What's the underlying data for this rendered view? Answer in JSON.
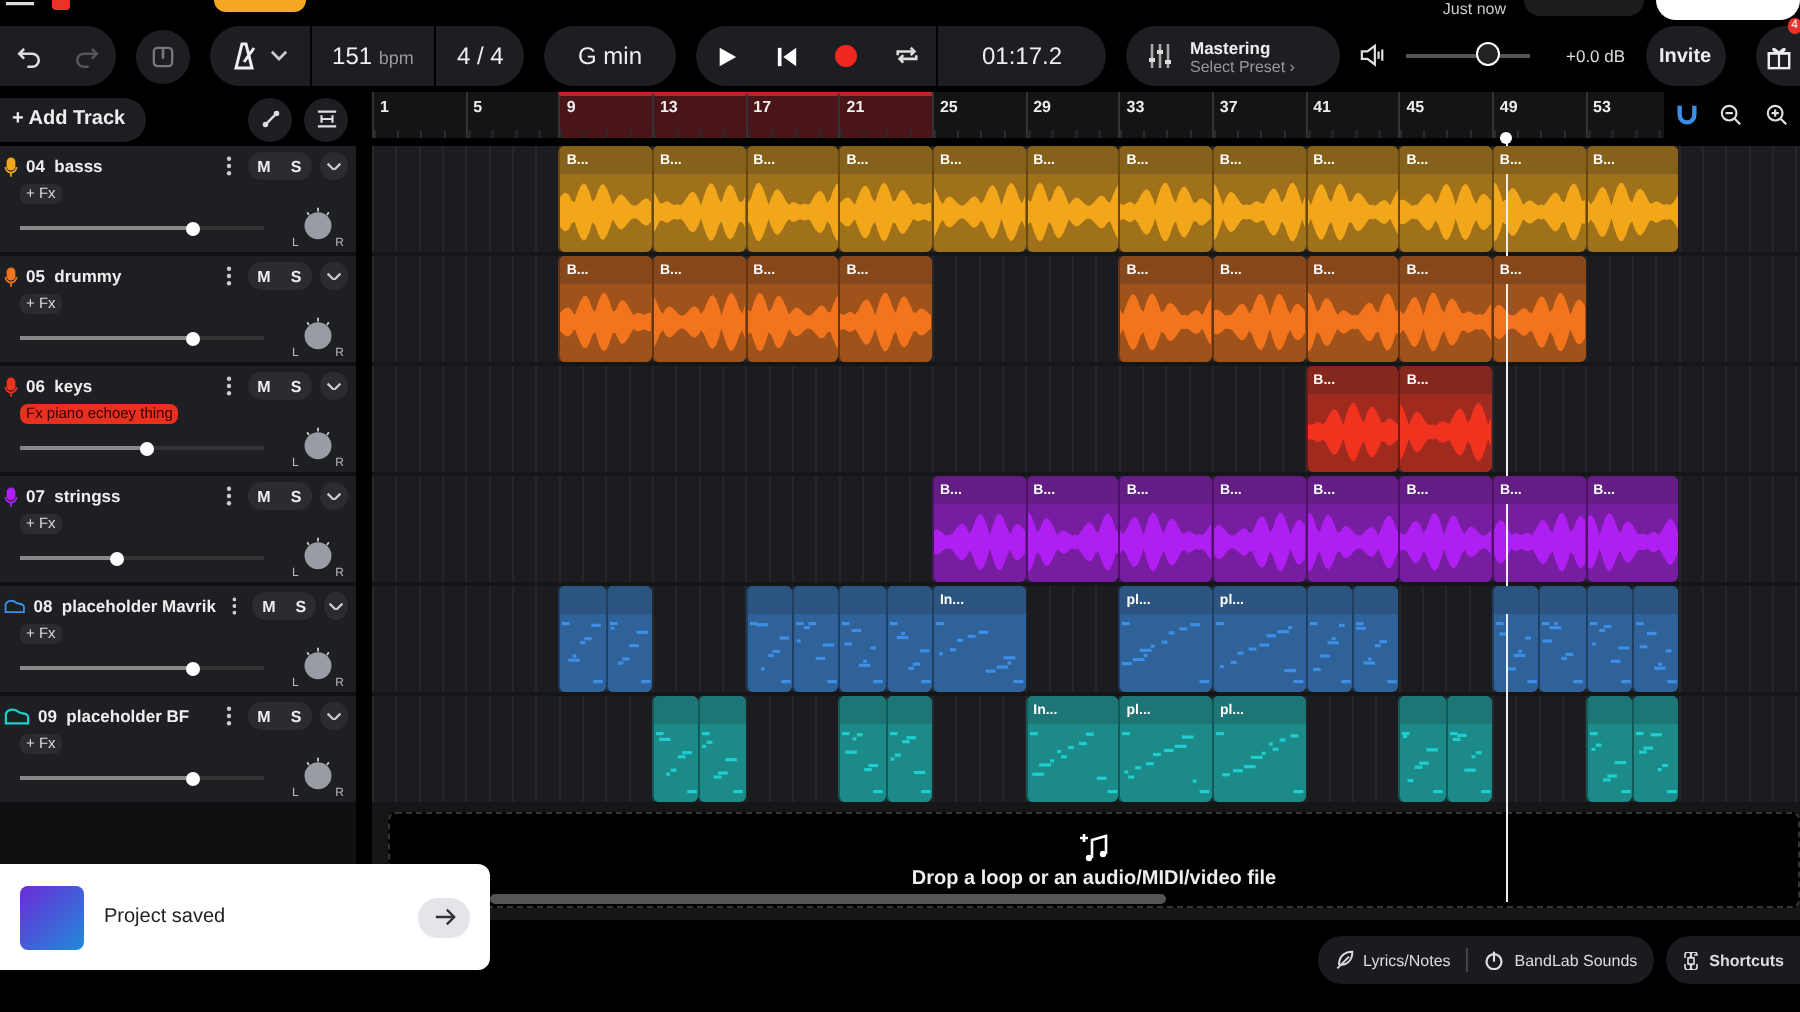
{
  "header": {
    "save_status": "Just now"
  },
  "toolbar": {
    "undo": {
      "disabled": false
    },
    "redo": {
      "disabled": true
    },
    "tempo": "151",
    "tempo_unit": "bpm",
    "time_signature": "4 / 4",
    "key": "G min",
    "time": "01:17.2",
    "mastering": {
      "title": "Mastering",
      "preset": "Select Preset ›"
    },
    "volume": {
      "level": 0.66
    },
    "gain": "+0.0 dB",
    "invite": "Invite",
    "gift_badge": "4"
  },
  "add_track": "+ Add Track",
  "ruler": [
    {
      "label": "1",
      "in_loop": false
    },
    {
      "label": "5",
      "in_loop": false
    },
    {
      "label": "9",
      "in_loop": true
    },
    {
      "label": "13",
      "in_loop": true
    },
    {
      "label": "17",
      "in_loop": true
    },
    {
      "label": "21",
      "in_loop": true
    },
    {
      "label": "25",
      "in_loop": false
    },
    {
      "label": "29",
      "in_loop": false
    },
    {
      "label": "33",
      "in_loop": false
    },
    {
      "label": "37",
      "in_loop": false
    },
    {
      "label": "41",
      "in_loop": false
    },
    {
      "label": "45",
      "in_loop": false
    },
    {
      "label": "49",
      "in_loop": false
    },
    {
      "label": "53",
      "in_loop": false
    }
  ],
  "tracks": [
    {
      "name": "04  basss",
      "kind": "audio",
      "color": "#f2a71b",
      "fx": {
        "label": "+ Fx",
        "active": false
      },
      "mute": "M",
      "solo": "S",
      "level": 0.71,
      "pan": {
        "left": "L",
        "right": "R"
      },
      "cells": [
        {
          "kind": "empty"
        },
        {
          "kind": "empty"
        },
        {
          "kind": "empty"
        },
        {
          "kind": "empty"
        },
        {
          "kind": "start",
          "label": "B..."
        },
        {
          "kind": "cont"
        },
        {
          "kind": "start",
          "label": "B..."
        },
        {
          "kind": "cont"
        },
        {
          "kind": "start",
          "label": "B..."
        },
        {
          "kind": "cont"
        },
        {
          "kind": "start",
          "label": "B..."
        },
        {
          "kind": "cont"
        },
        {
          "kind": "start",
          "label": "B..."
        },
        {
          "kind": "cont"
        },
        {
          "kind": "start",
          "label": "B..."
        },
        {
          "kind": "cont"
        },
        {
          "kind": "start",
          "label": "B..."
        },
        {
          "kind": "cont"
        },
        {
          "kind": "start",
          "label": "B..."
        },
        {
          "kind": "cont"
        },
        {
          "kind": "start",
          "label": "B..."
        },
        {
          "kind": "cont"
        },
        {
          "kind": "start",
          "label": "B..."
        },
        {
          "kind": "cont"
        },
        {
          "kind": "start",
          "label": "B..."
        },
        {
          "kind": "cont"
        },
        {
          "kind": "start",
          "label": "B..."
        },
        {
          "kind": "cont"
        }
      ]
    },
    {
      "name": "05  drummy",
      "kind": "audio",
      "color": "#f2741c",
      "fx": {
        "label": "+ Fx",
        "active": false
      },
      "mute": "M",
      "solo": "S",
      "level": 0.71,
      "pan": {
        "left": "L",
        "right": "R"
      },
      "cells": [
        {
          "kind": "empty"
        },
        {
          "kind": "empty"
        },
        {
          "kind": "empty"
        },
        {
          "kind": "empty"
        },
        {
          "kind": "start",
          "label": "B..."
        },
        {
          "kind": "cont"
        },
        {
          "kind": "start",
          "label": "B..."
        },
        {
          "kind": "cont"
        },
        {
          "kind": "start",
          "label": "B..."
        },
        {
          "kind": "cont"
        },
        {
          "kind": "start",
          "label": "B..."
        },
        {
          "kind": "cont"
        },
        {
          "kind": "empty"
        },
        {
          "kind": "empty"
        },
        {
          "kind": "empty"
        },
        {
          "kind": "empty"
        },
        {
          "kind": "start",
          "label": "B..."
        },
        {
          "kind": "cont"
        },
        {
          "kind": "start",
          "label": "B..."
        },
        {
          "kind": "cont"
        },
        {
          "kind": "start",
          "label": "B..."
        },
        {
          "kind": "cont"
        },
        {
          "kind": "start",
          "label": "B..."
        },
        {
          "kind": "cont"
        },
        {
          "kind": "start",
          "label": "B..."
        },
        {
          "kind": "cont"
        },
        {
          "kind": "empty"
        },
        {
          "kind": "empty"
        }
      ]
    },
    {
      "name": "06  keys",
      "kind": "audio",
      "color": "#f0331f",
      "fx": {
        "label": "Fx piano echoey thing",
        "active": true
      },
      "mute": "M",
      "solo": "S",
      "level": 0.52,
      "pan": {
        "left": "L",
        "right": "R"
      },
      "cells": [
        {
          "kind": "empty"
        },
        {
          "kind": "empty"
        },
        {
          "kind": "empty"
        },
        {
          "kind": "empty"
        },
        {
          "kind": "empty"
        },
        {
          "kind": "empty"
        },
        {
          "kind": "empty"
        },
        {
          "kind": "empty"
        },
        {
          "kind": "empty"
        },
        {
          "kind": "empty"
        },
        {
          "kind": "empty"
        },
        {
          "kind": "empty"
        },
        {
          "kind": "empty"
        },
        {
          "kind": "empty"
        },
        {
          "kind": "empty"
        },
        {
          "kind": "empty"
        },
        {
          "kind": "empty"
        },
        {
          "kind": "empty"
        },
        {
          "kind": "empty"
        },
        {
          "kind": "empty"
        },
        {
          "kind": "start",
          "label": "B..."
        },
        {
          "kind": "cont"
        },
        {
          "kind": "start",
          "label": "B..."
        },
        {
          "kind": "cont"
        },
        {
          "kind": "empty"
        },
        {
          "kind": "empty"
        },
        {
          "kind": "empty"
        },
        {
          "kind": "empty"
        }
      ]
    },
    {
      "name": "07  stringss",
      "kind": "audio",
      "color": "#b01ff2",
      "fx": {
        "label": "+ Fx",
        "active": false
      },
      "mute": "M",
      "solo": "S",
      "level": 0.4,
      "pan": {
        "left": "L",
        "right": "R"
      },
      "cells": [
        {
          "kind": "empty"
        },
        {
          "kind": "empty"
        },
        {
          "kind": "empty"
        },
        {
          "kind": "empty"
        },
        {
          "kind": "empty"
        },
        {
          "kind": "empty"
        },
        {
          "kind": "empty"
        },
        {
          "kind": "empty"
        },
        {
          "kind": "empty"
        },
        {
          "kind": "empty"
        },
        {
          "kind": "empty"
        },
        {
          "kind": "empty"
        },
        {
          "kind": "start",
          "label": "B..."
        },
        {
          "kind": "cont"
        },
        {
          "kind": "start",
          "label": "B..."
        },
        {
          "kind": "cont"
        },
        {
          "kind": "start",
          "label": "B..."
        },
        {
          "kind": "cont"
        },
        {
          "kind": "start",
          "label": "B..."
        },
        {
          "kind": "cont"
        },
        {
          "kind": "start",
          "label": "B..."
        },
        {
          "kind": "cont"
        },
        {
          "kind": "start",
          "label": "B..."
        },
        {
          "kind": "cont"
        },
        {
          "kind": "start",
          "label": "B..."
        },
        {
          "kind": "cont"
        },
        {
          "kind": "start",
          "label": "B..."
        },
        {
          "kind": "cont"
        }
      ]
    },
    {
      "name": "08  placeholder Mavrik",
      "kind": "midi",
      "color": "#3c8ee6",
      "fx": {
        "label": "+ Fx",
        "active": false
      },
      "mute": "M",
      "solo": "S",
      "level": 0.71,
      "pan": {
        "left": "L",
        "right": "R"
      },
      "cells": [
        {
          "kind": "empty"
        },
        {
          "kind": "empty"
        },
        {
          "kind": "empty"
        },
        {
          "kind": "empty"
        },
        {
          "kind": "start"
        },
        {
          "kind": "start"
        },
        {
          "kind": "empty"
        },
        {
          "kind": "empty"
        },
        {
          "kind": "start"
        },
        {
          "kind": "start"
        },
        {
          "kind": "start"
        },
        {
          "kind": "start"
        },
        {
          "kind": "start",
          "label": "In..."
        },
        {
          "kind": "cont"
        },
        {
          "kind": "empty"
        },
        {
          "kind": "empty"
        },
        {
          "kind": "start",
          "label": "pl..."
        },
        {
          "kind": "cont"
        },
        {
          "kind": "start",
          "label": "pl..."
        },
        {
          "kind": "cont"
        },
        {
          "kind": "start"
        },
        {
          "kind": "start"
        },
        {
          "kind": "empty"
        },
        {
          "kind": "empty"
        },
        {
          "kind": "start"
        },
        {
          "kind": "start"
        },
        {
          "kind": "start"
        },
        {
          "kind": "start"
        }
      ]
    },
    {
      "name": "09  placeholder BF",
      "kind": "midi",
      "color": "#1fcfcf",
      "fx": {
        "label": "+ Fx",
        "active": false
      },
      "mute": "M",
      "solo": "S",
      "level": 0.71,
      "pan": {
        "left": "L",
        "right": "R"
      },
      "cells": [
        {
          "kind": "empty"
        },
        {
          "kind": "empty"
        },
        {
          "kind": "empty"
        },
        {
          "kind": "empty"
        },
        {
          "kind": "empty"
        },
        {
          "kind": "empty"
        },
        {
          "kind": "start"
        },
        {
          "kind": "start"
        },
        {
          "kind": "empty"
        },
        {
          "kind": "empty"
        },
        {
          "kind": "start"
        },
        {
          "kind": "start"
        },
        {
          "kind": "empty"
        },
        {
          "kind": "empty"
        },
        {
          "kind": "start",
          "label": "In..."
        },
        {
          "kind": "cont"
        },
        {
          "kind": "start",
          "label": "pl..."
        },
        {
          "kind": "cont"
        },
        {
          "kind": "start",
          "label": "pl..."
        },
        {
          "kind": "cont"
        },
        {
          "kind": "empty"
        },
        {
          "kind": "empty"
        },
        {
          "kind": "start"
        },
        {
          "kind": "start"
        },
        {
          "kind": "empty"
        },
        {
          "kind": "empty"
        },
        {
          "kind": "start"
        },
        {
          "kind": "start"
        }
      ]
    }
  ],
  "drop_zone": "Drop a loop or an audio/MIDI/video file",
  "toast": {
    "message": "Project saved"
  },
  "footer_buttons": [
    {
      "label": "Lyrics/Notes",
      "kind": "lyrics"
    },
    {
      "label": "BandLab Sounds",
      "kind": "sounds"
    },
    {
      "label": "Shortcuts",
      "kind": "shortcuts"
    }
  ]
}
